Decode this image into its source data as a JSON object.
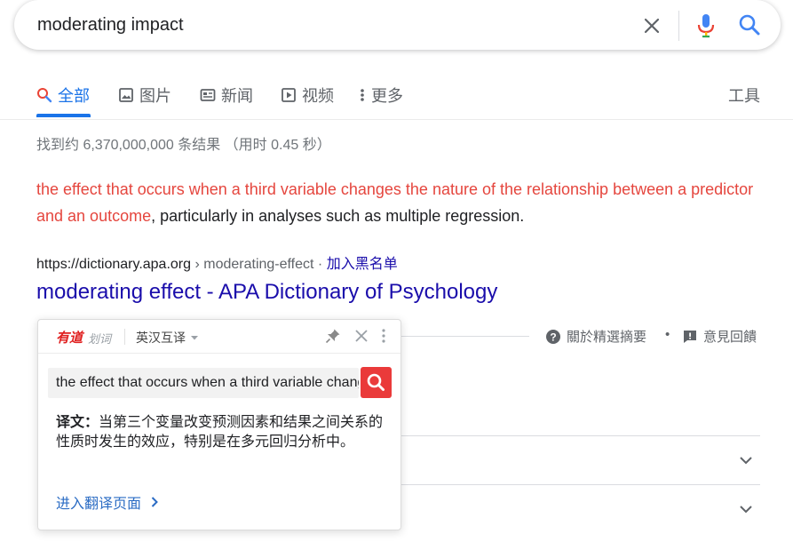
{
  "search": {
    "query": "moderating impact"
  },
  "tabs": [
    {
      "label": "全部",
      "icon": "search-icon"
    },
    {
      "label": "图片",
      "icon": "image-icon"
    },
    {
      "label": "新闻",
      "icon": "news-icon"
    },
    {
      "label": "视频",
      "icon": "video-icon"
    },
    {
      "label": "更多",
      "icon": "more-vert-icon"
    }
  ],
  "tools_label": "工具",
  "result_stats": "找到约 6,370,000,000 条结果 （用时 0.45 秒）",
  "snippet": {
    "highlight": "the effect that occurs when a third variable changes the nature of the relationship between a predictor and an outcome",
    "rest": ", particularly in analyses such as multiple regression."
  },
  "result": {
    "domain": "https://dictionary.apa.org",
    "path": " › moderating-effect",
    "separator": " · ",
    "block_label": "加入黑名单",
    "title": "moderating effect - APA Dictionary of Psychology"
  },
  "snippet_footer": {
    "about_label": "關於精選摘要",
    "dot": "•",
    "feedback_label": "意見回饋"
  },
  "youdao": {
    "logo": "有道",
    "sub": "划词",
    "mode": "英汉互译",
    "input_value": "the effect that occurs when a third variable changes",
    "result_label": "译文：",
    "result_text": "当第三个变量改变预测因素和结果之间关系的性质时发生的效应，特别是在多元回归分析中。",
    "link_label": "进入翻译页面"
  },
  "colors": {
    "accent": "#1a73e8",
    "link": "#1a0dab",
    "highlight": "#e5463e",
    "youdao_red": "#ea3a3a"
  }
}
